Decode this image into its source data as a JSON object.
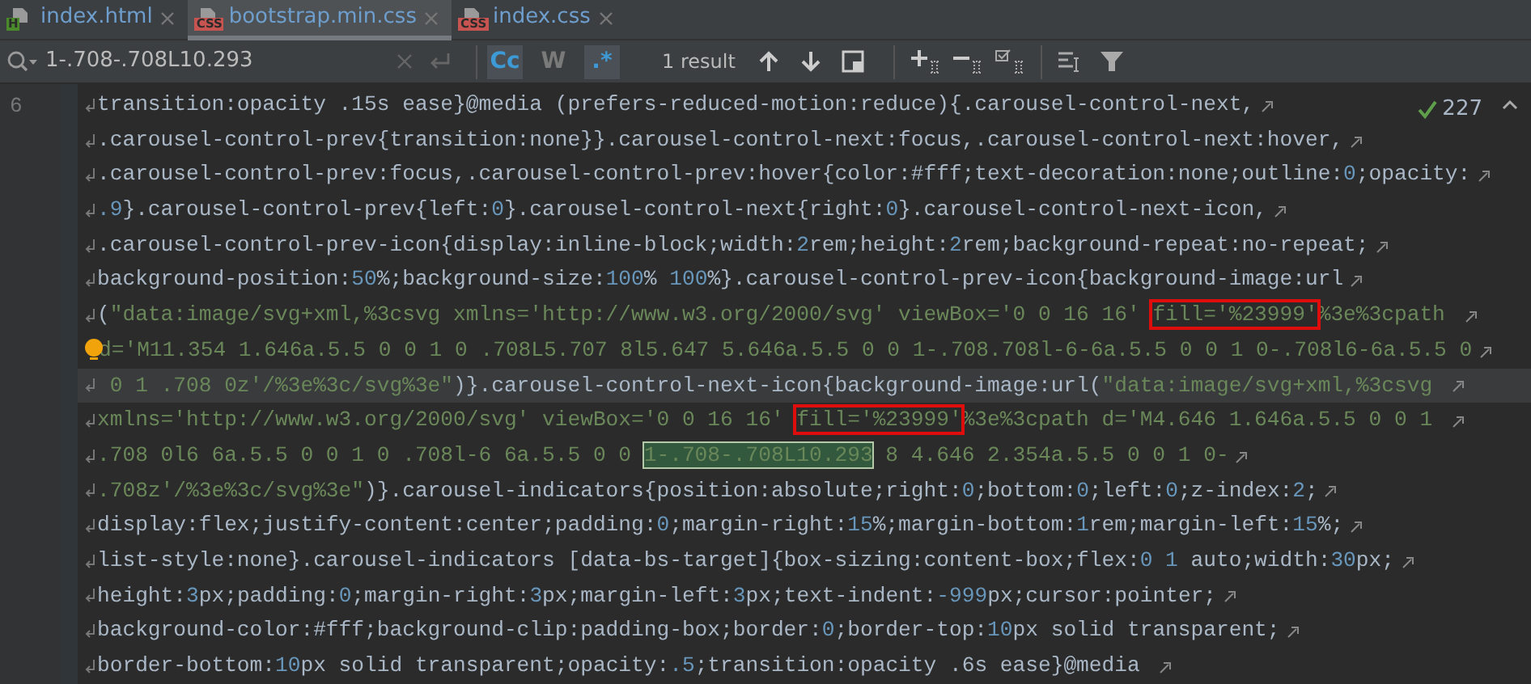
{
  "tabs": [
    {
      "label": "index.html",
      "badge": "H",
      "kind": "html",
      "selected": false
    },
    {
      "label": "bootstrap.min.css",
      "badge": "CSS",
      "kind": "css",
      "selected": true
    },
    {
      "label": "index.css",
      "badge": "CSS",
      "kind": "css",
      "selected": false
    }
  ],
  "search": {
    "query": "1-.708-.708L10.293",
    "options": [
      {
        "label": "Cc",
        "selected": true
      },
      {
        "label": "W",
        "selected": false
      },
      {
        "label": ".*",
        "selected": true
      }
    ],
    "result_count": "1 result"
  },
  "inspections": {
    "count": "227"
  },
  "gutter": {
    "line_number": "6"
  },
  "lines": [
    {
      "wrap_start": true,
      "wrap_end": true,
      "bulb": false,
      "current": false,
      "segments": [
        {
          "kind": "text",
          "text": "transition:opacity .15s ease}@media (prefers-reduced-motion:reduce){.carousel-control-next,"
        }
      ]
    },
    {
      "wrap_start": true,
      "wrap_end": true,
      "bulb": false,
      "current": false,
      "segments": [
        {
          "kind": "text",
          "text": ".carousel-control-prev{transition:none}}.carousel-control-next:focus,.carousel-control-next:hover,"
        }
      ]
    },
    {
      "wrap_start": true,
      "wrap_end": true,
      "bulb": false,
      "current": false,
      "segments": [
        {
          "kind": "text",
          "text": ".carousel-control-prev:focus,.carousel-control-prev:hover{color:#fff;text-decoration:none;outline:"
        },
        {
          "kind": "num",
          "text": "0"
        },
        {
          "kind": "text",
          "text": ";opacity:"
        }
      ]
    },
    {
      "wrap_start": true,
      "wrap_end": true,
      "bulb": false,
      "current": false,
      "segments": [
        {
          "kind": "num",
          "text": ".9"
        },
        {
          "kind": "text",
          "text": "}.carousel-control-prev{left:"
        },
        {
          "kind": "num",
          "text": "0"
        },
        {
          "kind": "text",
          "text": "}.carousel-control-next{right:"
        },
        {
          "kind": "num",
          "text": "0"
        },
        {
          "kind": "text",
          "text": "}.carousel-control-next-icon,"
        }
      ]
    },
    {
      "wrap_start": true,
      "wrap_end": true,
      "bulb": false,
      "current": false,
      "segments": [
        {
          "kind": "text",
          "text": ".carousel-control-prev-icon{display:inline-block;width:"
        },
        {
          "kind": "num",
          "text": "2"
        },
        {
          "kind": "text",
          "text": "rem;height:"
        },
        {
          "kind": "num",
          "text": "2"
        },
        {
          "kind": "text",
          "text": "rem;background-repeat:no-repeat;"
        }
      ]
    },
    {
      "wrap_start": true,
      "wrap_end": true,
      "bulb": false,
      "current": false,
      "segments": [
        {
          "kind": "text",
          "text": "background-position:"
        },
        {
          "kind": "num",
          "text": "50"
        },
        {
          "kind": "text",
          "text": "%;background-size:"
        },
        {
          "kind": "num",
          "text": "100"
        },
        {
          "kind": "text",
          "text": "% "
        },
        {
          "kind": "num",
          "text": "100"
        },
        {
          "kind": "text",
          "text": "%}.carousel-control-prev-icon{background-image:url"
        }
      ]
    },
    {
      "wrap_start": true,
      "wrap_end": true,
      "bulb": false,
      "current": false,
      "segments": [
        {
          "kind": "text",
          "text": "("
        },
        {
          "kind": "str",
          "text": "\"data:image/svg+xml,%3csvg xmlns='http://www.w3.org/2000/svg' viewBox='0 0 16 16' "
        },
        {
          "kind": "boxed",
          "text": "fill='%23999'"
        },
        {
          "kind": "str",
          "text": "%3e%3cpath "
        }
      ]
    },
    {
      "wrap_start": false,
      "wrap_end": true,
      "bulb": true,
      "current": false,
      "segments": [
        {
          "kind": "str",
          "text": "d='M11.354 1.646a.5.5 0 0 1 0 .708L5.707 8l5.647 5.646a.5.5 0 0 1-.708.708l-6-6a.5.5 0 0 1 0-.708l6-6a.5.5 0"
        }
      ]
    },
    {
      "wrap_start": true,
      "wrap_end": true,
      "bulb": false,
      "current": true,
      "segments": [
        {
          "kind": "str",
          "text": " 0 1 .708 0z'/%3e%3c/svg%3e\""
        },
        {
          "kind": "text",
          "text": ")}.carousel-control-next-icon{background-image:url("
        },
        {
          "kind": "str",
          "text": "\"data:image/svg+xml,%3csvg "
        }
      ]
    },
    {
      "wrap_start": true,
      "wrap_end": true,
      "bulb": false,
      "current": false,
      "segments": [
        {
          "kind": "str",
          "text": "xmlns='http://www.w3.org/2000/svg' viewBox='0 0 16 16' "
        },
        {
          "kind": "boxed",
          "text": "fill='%23999'"
        },
        {
          "kind": "str",
          "text": "%3e%3cpath d='M4.646 1.646a.5.5 0 0 1 "
        }
      ]
    },
    {
      "wrap_start": true,
      "wrap_end": true,
      "bulb": false,
      "current": false,
      "segments": [
        {
          "kind": "str",
          "text": ".708 0l6 6a.5.5 0 0 1 0 .708l-6 6a.5.5 0 0 "
        },
        {
          "kind": "match",
          "text": "1-.708-.708L10.293"
        },
        {
          "kind": "str",
          "text": " 8 4.646 2.354a.5.5 0 0 1 0-"
        }
      ]
    },
    {
      "wrap_start": true,
      "wrap_end": true,
      "bulb": false,
      "current": false,
      "segments": [
        {
          "kind": "str",
          "text": ".708z'/%3e%3c/svg%3e\""
        },
        {
          "kind": "text",
          "text": ")}.carousel-indicators{position:absolute;right:"
        },
        {
          "kind": "num",
          "text": "0"
        },
        {
          "kind": "text",
          "text": ";bottom:"
        },
        {
          "kind": "num",
          "text": "0"
        },
        {
          "kind": "text",
          "text": ";left:"
        },
        {
          "kind": "num",
          "text": "0"
        },
        {
          "kind": "text",
          "text": ";z-index:"
        },
        {
          "kind": "num",
          "text": "2"
        },
        {
          "kind": "text",
          "text": ";"
        }
      ]
    },
    {
      "wrap_start": true,
      "wrap_end": true,
      "bulb": false,
      "current": false,
      "segments": [
        {
          "kind": "text",
          "text": "display:flex;justify-content:center;padding:"
        },
        {
          "kind": "num",
          "text": "0"
        },
        {
          "kind": "text",
          "text": ";margin-right:"
        },
        {
          "kind": "num",
          "text": "15"
        },
        {
          "kind": "text",
          "text": "%;margin-bottom:"
        },
        {
          "kind": "num",
          "text": "1"
        },
        {
          "kind": "text",
          "text": "rem;margin-left:"
        },
        {
          "kind": "num",
          "text": "15"
        },
        {
          "kind": "text",
          "text": "%;"
        }
      ]
    },
    {
      "wrap_start": true,
      "wrap_end": true,
      "bulb": false,
      "current": false,
      "segments": [
        {
          "kind": "text",
          "text": "list-style:none}.carousel-indicators [data-bs-target]{box-sizing:content-box;flex:"
        },
        {
          "kind": "num",
          "text": "0 1"
        },
        {
          "kind": "text",
          "text": " auto;width:"
        },
        {
          "kind": "num",
          "text": "30"
        },
        {
          "kind": "text",
          "text": "px;"
        }
      ]
    },
    {
      "wrap_start": true,
      "wrap_end": true,
      "bulb": false,
      "current": false,
      "segments": [
        {
          "kind": "text",
          "text": "height:"
        },
        {
          "kind": "num",
          "text": "3"
        },
        {
          "kind": "text",
          "text": "px;padding:"
        },
        {
          "kind": "num",
          "text": "0"
        },
        {
          "kind": "text",
          "text": ";margin-right:"
        },
        {
          "kind": "num",
          "text": "3"
        },
        {
          "kind": "text",
          "text": "px;margin-left:"
        },
        {
          "kind": "num",
          "text": "3"
        },
        {
          "kind": "text",
          "text": "px;text-indent:"
        },
        {
          "kind": "num",
          "text": "-999"
        },
        {
          "kind": "text",
          "text": "px;cursor:pointer;"
        }
      ]
    },
    {
      "wrap_start": true,
      "wrap_end": true,
      "bulb": false,
      "current": false,
      "segments": [
        {
          "kind": "text",
          "text": "background-color:#fff;background-clip:padding-box;border:"
        },
        {
          "kind": "num",
          "text": "0"
        },
        {
          "kind": "text",
          "text": ";border-top:"
        },
        {
          "kind": "num",
          "text": "10"
        },
        {
          "kind": "text",
          "text": "px solid transparent;"
        }
      ]
    },
    {
      "wrap_start": true,
      "wrap_end": true,
      "bulb": false,
      "current": false,
      "segments": [
        {
          "kind": "text",
          "text": "border-bottom:"
        },
        {
          "kind": "num",
          "text": "10"
        },
        {
          "kind": "text",
          "text": "px solid transparent;opacity:"
        },
        {
          "kind": "num",
          "text": ".5"
        },
        {
          "kind": "text",
          "text": ";transition:opacity .6s ease}@media "
        }
      ]
    }
  ]
}
